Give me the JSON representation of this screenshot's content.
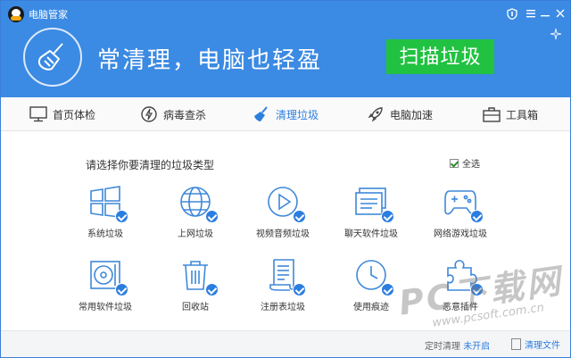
{
  "window": {
    "title": "电脑管家"
  },
  "header": {
    "slogan": "常清理，电脑也轻盈",
    "scan_button": "扫描垃圾",
    "colors": {
      "header_bg": "#3b8ae3",
      "scan_button": "#21c241",
      "accent": "#2b7de0"
    }
  },
  "tabs": [
    {
      "label": "首页体检",
      "icon": "monitor-icon"
    },
    {
      "label": "病毒查杀",
      "icon": "shield-bolt-icon"
    },
    {
      "label": "清理垃圾",
      "icon": "broom-icon",
      "active": true
    },
    {
      "label": "电脑加速",
      "icon": "rocket-icon"
    },
    {
      "label": "工具箱",
      "icon": "toolbox-icon"
    }
  ],
  "main": {
    "prompt": "请选择你要清理的垃圾类型",
    "select_all": "全选",
    "items": [
      {
        "label": "系统垃圾",
        "icon": "windows-icon",
        "checked": true
      },
      {
        "label": "上网垃圾",
        "icon": "globe-icon",
        "checked": true
      },
      {
        "label": "视频音频垃圾",
        "icon": "play-icon",
        "checked": true
      },
      {
        "label": "聊天软件垃圾",
        "icon": "chat-icon",
        "checked": true
      },
      {
        "label": "网络游戏垃圾",
        "icon": "gamepad-icon",
        "checked": true
      },
      {
        "label": "常用软件垃圾",
        "icon": "disc-icon",
        "checked": true
      },
      {
        "label": "回收站",
        "icon": "trash-icon",
        "checked": true
      },
      {
        "label": "注册表垃圾",
        "icon": "registry-icon",
        "checked": true
      },
      {
        "label": "使用痕迹",
        "icon": "clock-icon",
        "checked": true
      },
      {
        "label": "恶意插件",
        "icon": "puzzle-icon",
        "checked": true
      }
    ]
  },
  "footer": {
    "status_prefix": "定时清理",
    "status_value": "未开启",
    "clean_file": "清理文件"
  },
  "watermark": {
    "main": "PC下载网",
    "sub": "www.pcsoft.com.cn"
  }
}
